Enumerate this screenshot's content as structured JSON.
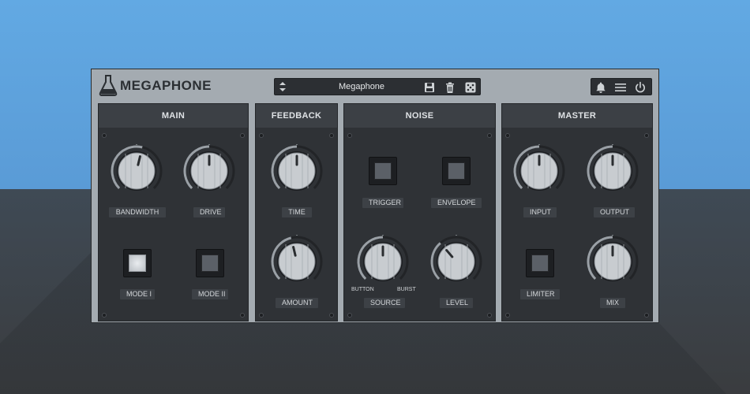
{
  "app": {
    "title": "MEGAPHONE"
  },
  "preset": {
    "name": "Megaphone",
    "up_down_icon": "up-down-arrows-icon",
    "icons": [
      "save-icon",
      "trash-icon",
      "dice-icon"
    ]
  },
  "toolbar_right": {
    "icons": [
      "bell-icon",
      "menu-icon",
      "power-icon"
    ]
  },
  "panels": {
    "main": {
      "title": "MAIN",
      "knobs": [
        {
          "label": "BANDWIDTH",
          "value": 0.55
        },
        {
          "label": "DRIVE",
          "value": 0.5
        }
      ],
      "buttons": [
        {
          "label": "MODE I",
          "on": true
        },
        {
          "label": "MODE II",
          "on": false
        }
      ]
    },
    "feedback": {
      "title": "FEEDBACK",
      "knobs": [
        {
          "label": "TIME",
          "value": 0.5
        },
        {
          "label": "AMOUNT",
          "value": 0.45
        }
      ]
    },
    "noise": {
      "title": "NOISE",
      "buttons": [
        {
          "label": "TRIGGER",
          "on": false
        },
        {
          "label": "ENVELOPE",
          "on": false
        }
      ],
      "knobs": [
        {
          "label": "SOURCE",
          "value": 0.5,
          "min_label": "BUTTON",
          "max_label": "BURST"
        },
        {
          "label": "LEVEL",
          "value": 0.35
        }
      ]
    },
    "master": {
      "title": "MASTER",
      "knobs": [
        {
          "label": "INPUT",
          "value": 0.5
        },
        {
          "label": "OUTPUT",
          "value": 0.5
        },
        {
          "label": "MIX",
          "value": 0.5
        }
      ],
      "buttons": [
        {
          "label": "LIMITER",
          "on": false
        }
      ]
    }
  }
}
